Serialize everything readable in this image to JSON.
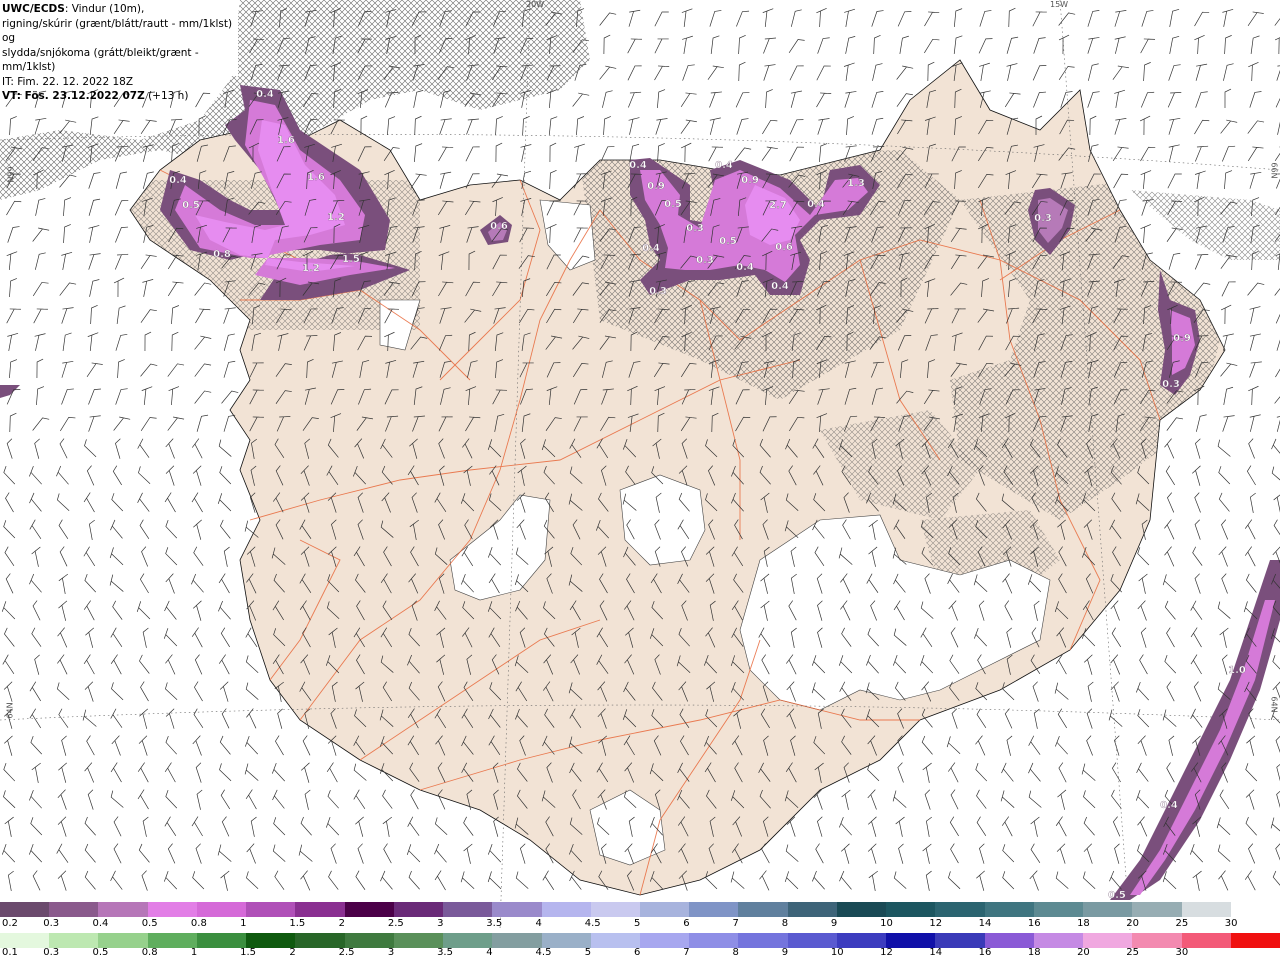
{
  "header": {
    "product": "UWC/ECDS",
    "line1_rest": ": Vindur (10m),",
    "line2": "rigning/skúrir (grænt/blátt/rautt - mm/1klst) og",
    "line3": "slydda/snjókoma (grátt/bleikt/grænt - mm/1klst)",
    "it_line": "IT: Fim. 22. 12. 2022 18Z",
    "vt_label": "VT: Fös. 23.12.2022 07Z",
    "vt_step": " (+13 h)"
  },
  "graticule_labels": {
    "lon_20w": "20W",
    "lon_15w": "15W",
    "lat_66n_left": "66N",
    "lat_66n_right": "66N",
    "lat_64n_left": "64N",
    "lat_64n_right": "64N"
  },
  "precip_labels": [
    {
      "text": "0.4"
    },
    {
      "text": "1.6"
    },
    {
      "text": "1.6"
    },
    {
      "text": "0.4"
    },
    {
      "text": "0.5"
    },
    {
      "text": "1.2"
    },
    {
      "text": "0.8"
    },
    {
      "text": "1.2"
    },
    {
      "text": "1.5"
    },
    {
      "text": "0.6"
    },
    {
      "text": "0.4"
    },
    {
      "text": "0.9"
    },
    {
      "text": "0.5"
    },
    {
      "text": "0.3"
    },
    {
      "text": "0.4"
    },
    {
      "text": "0.5"
    },
    {
      "text": "0.3"
    },
    {
      "text": "0.3"
    },
    {
      "text": "0.4"
    },
    {
      "text": "0.9"
    },
    {
      "text": "2.7"
    },
    {
      "text": "0.4"
    },
    {
      "text": "1.3"
    },
    {
      "text": "0.6"
    },
    {
      "text": "0.4"
    },
    {
      "text": "0.4"
    },
    {
      "text": "0.3"
    },
    {
      "text": "0.9"
    },
    {
      "text": "0.3"
    },
    {
      "text": "1.0"
    },
    {
      "text": "0.4"
    },
    {
      "text": "0.5"
    }
  ],
  "legend_snow": {
    "colors": [
      "#6b4a6d",
      "#8a5a8c",
      "#b676b8",
      "#e27ee6",
      "#d56ad8",
      "#b050b8",
      "#8a2f91",
      "#4b0048",
      "#6a2a78",
      "#7a5a9a",
      "#9a8acb",
      "#b5b5ee",
      "#c9c9ef",
      "#a7b3dd",
      "#7f94c6",
      "#60809e",
      "#3e6479",
      "#1a4a55",
      "#1c5660",
      "#2b6470",
      "#3f7580",
      "#5d8a92",
      "#7a9aa2",
      "#97adb3",
      "#d7dde0",
      "#ffffff"
    ],
    "labels": [
      "0.2",
      "0.3",
      "0.4",
      "0.5",
      "0.8",
      "1",
      "1.5",
      "2",
      "2.5",
      "3",
      "3.5",
      "4",
      "4.5",
      "5",
      "6",
      "7",
      "8",
      "9",
      "10",
      "12",
      "14",
      "16",
      "18",
      "20",
      "25",
      "30"
    ]
  },
  "legend_rain": {
    "colors": [
      "#e4f8de",
      "#bde8b1",
      "#96d18c",
      "#5fae5e",
      "#3b8f3f",
      "#0f5a0f",
      "#286628",
      "#3f7a3f",
      "#5a905a",
      "#6e9e8a",
      "#839ea0",
      "#9ab0c8",
      "#b8c0ef",
      "#a7a7ef",
      "#8e8ee6",
      "#7474dd",
      "#5a5ad0",
      "#3c3cbf",
      "#1010a8",
      "#3a3ab8",
      "#8a5ad6",
      "#c58ae4",
      "#f0a8e0",
      "#f38ab0",
      "#f35a78",
      "#f01010"
    ],
    "labels": [
      "0.1",
      "0.3",
      "0.5",
      "0.8",
      "1",
      "1.5",
      "2",
      "2.5",
      "3",
      "3.5",
      "4",
      "4.5",
      "5",
      "6",
      "7",
      "8",
      "9",
      "10",
      "12",
      "14",
      "16",
      "18",
      "20",
      "25",
      "30"
    ]
  }
}
